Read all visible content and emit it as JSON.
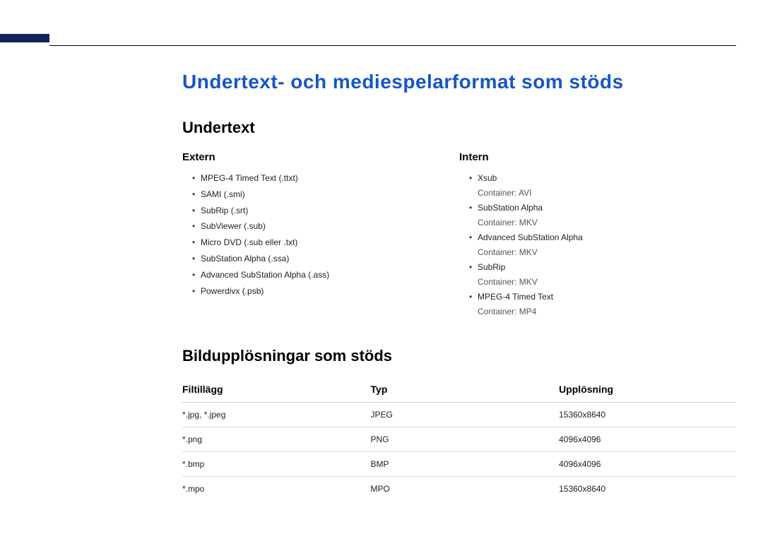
{
  "page_title": "Undertext- och mediespelarformat som stöds",
  "subtitles": {
    "heading": "Undertext",
    "external": {
      "heading": "Extern",
      "items": [
        {
          "line": "MPEG-4 Timed Text (.ttxt)"
        },
        {
          "line": "SAMI (.smi)"
        },
        {
          "line": "SubRip (.srt)"
        },
        {
          "line": "SubViewer (.sub)"
        },
        {
          "line": "Micro DVD (.sub eller .txt)"
        },
        {
          "line": "SubStation Alpha (.ssa)"
        },
        {
          "line": "Advanced SubStation Alpha (.ass)"
        },
        {
          "line": "Powerdivx (.psb)"
        }
      ]
    },
    "internal": {
      "heading": "Intern",
      "items": [
        {
          "line": "Xsub",
          "sub": "Container: AVI"
        },
        {
          "line": "SubStation Alpha",
          "sub": "Container: MKV"
        },
        {
          "line": "Advanced SubStation Alpha",
          "sub": "Container: MKV"
        },
        {
          "line": "SubRip",
          "sub": "Container: MKV"
        },
        {
          "line": "MPEG-4 Timed Text",
          "sub": "Container: MP4"
        }
      ]
    }
  },
  "resolutions": {
    "heading": "Bildupplösningar som stöds",
    "columns": {
      "ext": "Filtillägg",
      "type": "Typ",
      "res": "Upplösning"
    },
    "rows": [
      {
        "ext": "*.jpg, *.jpeg",
        "type": "JPEG",
        "res": "15360x8640"
      },
      {
        "ext": "*.png",
        "type": "PNG",
        "res": "4096x4096"
      },
      {
        "ext": "*.bmp",
        "type": "BMP",
        "res": "4096x4096"
      },
      {
        "ext": "*.mpo",
        "type": "MPO",
        "res": "15360x8640"
      }
    ]
  }
}
